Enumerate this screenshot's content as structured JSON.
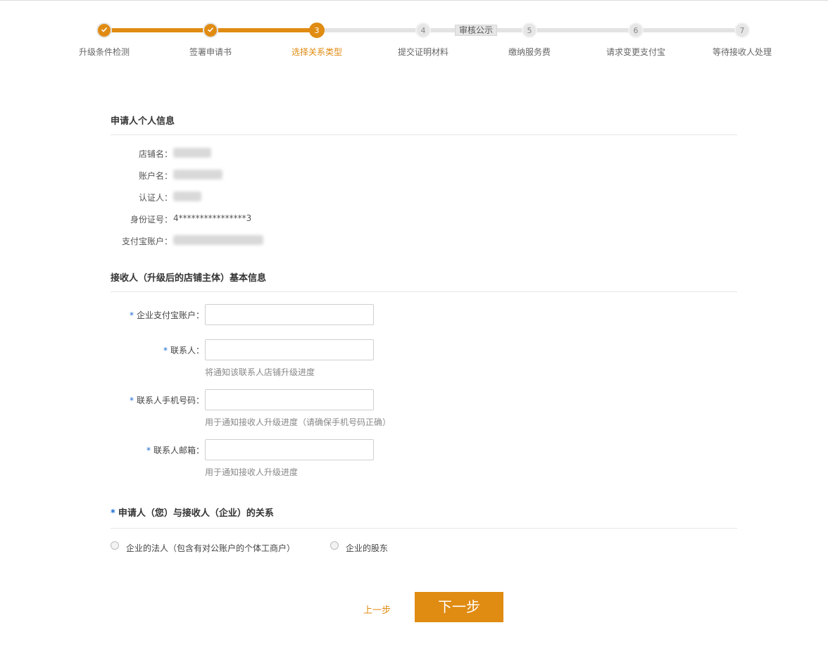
{
  "stepper": {
    "steps": [
      {
        "num": "1",
        "label": "升级条件检测",
        "state": "done"
      },
      {
        "num": "2",
        "label": "签署申请书",
        "state": "done"
      },
      {
        "num": "3",
        "label": "选择关系类型",
        "state": "active"
      },
      {
        "num": "4",
        "label": "提交证明材料",
        "state": "todo"
      },
      {
        "num": "5",
        "label": "缴纳服务费",
        "state": "todo"
      },
      {
        "num": "6",
        "label": "请求变更支付宝",
        "state": "todo"
      },
      {
        "num": "7",
        "label": "等待接收人处理",
        "state": "todo"
      }
    ],
    "review_badge": "审核公示"
  },
  "applicant": {
    "title": "申请人个人信息",
    "fields": [
      {
        "label": "店铺名：",
        "value": ""
      },
      {
        "label": "账户名：",
        "value": ""
      },
      {
        "label": "认证人：",
        "value": ""
      },
      {
        "label": "身份证号：",
        "value": "4****************3"
      },
      {
        "label": "支付宝账户：",
        "value": ""
      }
    ]
  },
  "receiver": {
    "title": "接收人（升级后的店铺主体）基本信息",
    "fields": [
      {
        "label": "企业支付宝账户：",
        "value": "",
        "placeholder": "",
        "hint": ""
      },
      {
        "label": "联系人：",
        "value": "",
        "placeholder": "",
        "hint": "将通知该联系人店铺升级进度"
      },
      {
        "label": "联系人手机号码：",
        "value": "",
        "placeholder": "",
        "hint": "用于通知接收人升级进度（请确保手机号码正确）"
      },
      {
        "label": "联系人邮箱：",
        "value": "",
        "placeholder": "",
        "hint": "用于通知接收人升级进度"
      }
    ],
    "required_mark": "*"
  },
  "relation": {
    "title": "申请人（您）与接收人（企业）的关系",
    "options": [
      {
        "label": "企业的法人（包含有对公账户的个体工商户）",
        "selected": false
      },
      {
        "label": "企业的股东",
        "selected": false
      }
    ]
  },
  "actions": {
    "prev_label": "上一步",
    "next_label": "下一步"
  },
  "colors": {
    "accent": "#e08b12",
    "required": "#1a6ad1"
  }
}
